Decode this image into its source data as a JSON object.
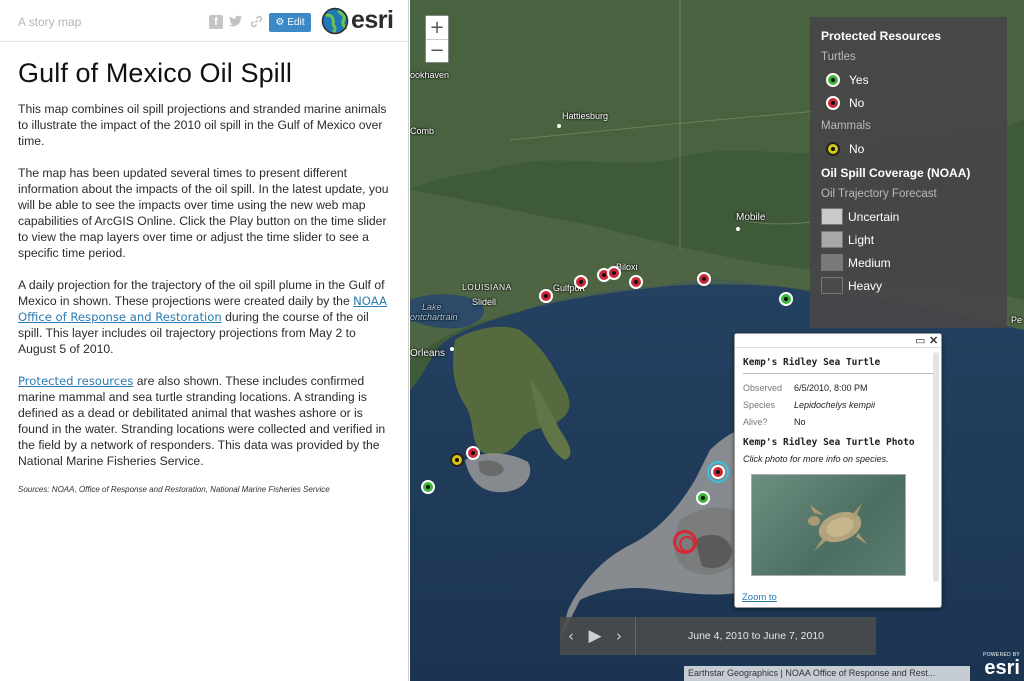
{
  "header": {
    "subtitle": "A story map",
    "edit_label": "Edit",
    "brand": "esri"
  },
  "story": {
    "title": "Gulf of Mexico Oil Spill",
    "p1": "This map combines oil spill projections and stranded marine animals to illustrate the impact of the 2010 oil spill in the Gulf of Mexico over time.",
    "p2": "The map has been updated several times to present different information about the impacts of the oil spill.  In the latest update, you will be able to see the impacts over time using the new web map capabilities of ArcGIS Online. Click the Play button on the time slider to view the map layers over time or adjust the time slider to see a specific time period.",
    "p3_before": "A daily projection for the trajectory of the oil spill plume in the Gulf of Mexico in shown. These projections were created daily by the ",
    "p3_link": "NOAA Office of Response and Restoration",
    "p3_after": " during the course of the oil spill. This layer includes oil trajectory projections from May 2 to August 5 of 2010.",
    "p4_link": "Protected resources",
    "p4_after": " are also shown. These includes confirmed marine mammal and sea turtle stranding locations. A stranding is defined as a dead or debilitated animal that washes ashore or is found in the water. Stranding locations were collected and verified in the field by a network of responders. This data was provided by the National Marine Fisheries Service.",
    "sources": "Sources: NOAA, Office of Response and Restoration, National Marine Fisheries Service"
  },
  "map": {
    "zoom_in": "+",
    "zoom_out": "−",
    "places": {
      "brookhaven": "ookhaven",
      "hattiesburg": "Hattiesburg",
      "comb": "Comb",
      "mobile": "Mobile",
      "biloxi": "Biloxi",
      "gulfport": "Gulfport",
      "louisiana": "LOUISIANA",
      "slidell": "Slidell",
      "lake1": "Lake",
      "lake2": "ontchartrain",
      "orleans": "Orleans",
      "pe": "Pe"
    },
    "attribution": "Earthstar Geographics | NOAA Office of Response and Rest...",
    "powered_by": "POWERED BY",
    "powered_brand": "esri"
  },
  "legend": {
    "heading1": "Protected Resources",
    "turtles": "Turtles",
    "yes": "Yes",
    "no": "No",
    "mammals": "Mammals",
    "mammal_no": "No",
    "heading2": "Oil Spill Coverage (NOAA)",
    "forecast": "Oil Trajectory Forecast",
    "uncertain": "Uncertain",
    "light": "Light",
    "medium": "Medium",
    "heavy": "Heavy",
    "colors": {
      "turtle_yes": "#3db43a",
      "turtle_no": "#c8283a",
      "mammal_no": "#d4c51a",
      "uncertain": "#c9c9c9",
      "light": "#a8a8a8",
      "medium": "#7a7a7a",
      "heavy": "#4a4a4a"
    }
  },
  "popup": {
    "title": "Kemp's Ridley Sea Turtle",
    "observed_label": "Observed",
    "observed_value": "6/5/2010, 8:00 PM",
    "species_label": "Species",
    "species_value": "Lepidochelys kempii",
    "alive_label": "Alive?",
    "alive_value": "No",
    "media_title": "Kemp's Ridley Sea Turtle Photo",
    "caption": "Click photo for more info on species.",
    "zoom_link": "Zoom to"
  },
  "timeslider": {
    "range": "June 4, 2010 to June 7, 2010"
  }
}
